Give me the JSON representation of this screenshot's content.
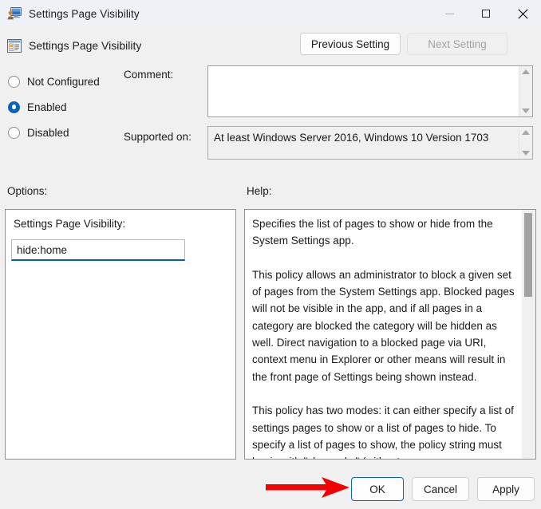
{
  "window": {
    "title": "Settings Page Visibility",
    "icon": "settings-policy-icon",
    "controls": {
      "minimize": "minimize-icon",
      "maximize": "maximize-icon",
      "close": "close-icon"
    }
  },
  "header": {
    "icon": "policy-setting-icon",
    "title": "Settings Page Visibility",
    "previous_setting_label": "Previous Setting",
    "next_setting_label": "Next Setting",
    "next_setting_disabled": true
  },
  "state": {
    "options": [
      "Not Configured",
      "Enabled",
      "Disabled"
    ],
    "selected": "Enabled"
  },
  "comment": {
    "label": "Comment:",
    "value": ""
  },
  "supported": {
    "label": "Supported on:",
    "value": "At least Windows Server 2016, Windows 10 Version 1703"
  },
  "options_panel": {
    "section_label": "Options:",
    "field_label": "Settings Page Visibility:",
    "input_value": "hide:home"
  },
  "help_panel": {
    "section_label": "Help:",
    "text": "Specifies the list of pages to show or hide from the System Settings app.\n\nThis policy allows an administrator to block a given set of pages from the System Settings app. Blocked pages will not be visible in the app, and if all pages in a category are blocked the category will be hidden as well. Direct navigation to a blocked page via URI, context menu in Explorer or other means will result in the front page of Settings being shown instead.\n\nThis policy has two modes: it can either specify a list of settings pages to show or a list of pages to hide. To specify a list of pages to show, the policy string must begin with \"showonly:\" (without"
  },
  "footer": {
    "ok_label": "OK",
    "cancel_label": "Cancel",
    "apply_label": "Apply"
  },
  "annotation": {
    "arrow_color": "#f50000",
    "arrow_target": "OK"
  }
}
